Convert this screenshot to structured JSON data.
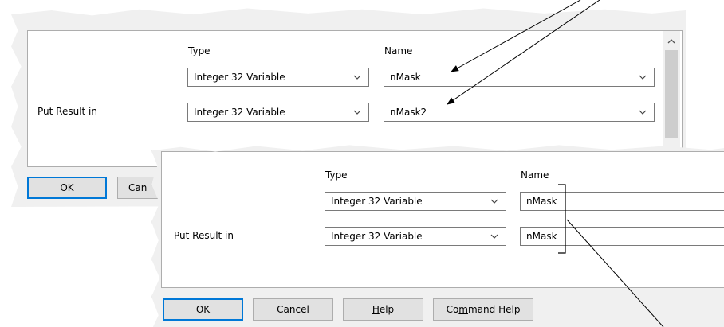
{
  "back_dialog": {
    "type_header": "Type",
    "name_header": "Name",
    "put_result_label": "Put Result in",
    "row1": {
      "type_value": "Integer 32 Variable",
      "name_value": "nMask"
    },
    "row2": {
      "type_value": "Integer 32 Variable",
      "name_value": "nMask2"
    },
    "ok_label": "OK",
    "cancel_label_partial": "Can"
  },
  "front_dialog": {
    "type_header": "Type",
    "name_header": "Name",
    "put_result_label": "Put Result in",
    "row1": {
      "type_value": "Integer 32 Variable",
      "name_value": "nMask"
    },
    "row2": {
      "type_value": "Integer 32 Variable",
      "name_value": "nMask"
    },
    "ok_label": "OK",
    "cancel_label": "Cancel",
    "help_label_mnemonic": "H",
    "help_label_rest": "elp",
    "command_help_prefix": "Co",
    "command_help_mnemonic": "m",
    "command_help_rest": "mand Help"
  },
  "colors": {
    "dialog_bg": "#f0f0f0",
    "default_button_border": "#0078d7",
    "annotation_line": "#000000"
  },
  "icons": [
    "chevron-down-icon",
    "chevron-up-icon"
  ]
}
